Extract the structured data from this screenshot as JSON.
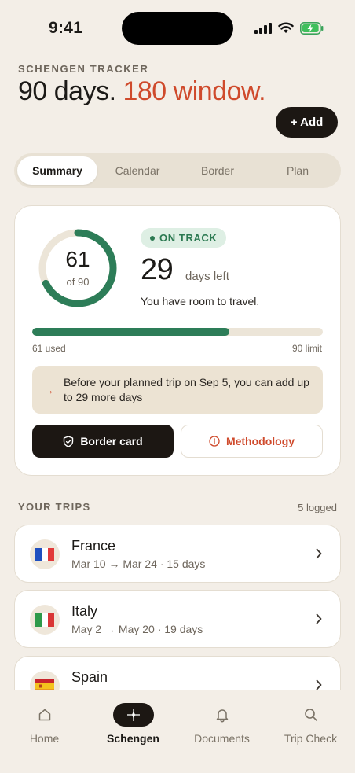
{
  "status_bar": {
    "time": "9:41"
  },
  "header": {
    "eyebrow": "SCHENGEN TRACKER",
    "headline_part1": "90 days.",
    "headline_part2": "180 window.",
    "add_label": "+ Add"
  },
  "tabs": [
    {
      "label": "Summary",
      "active": true
    },
    {
      "label": "Calendar",
      "active": false
    },
    {
      "label": "Border",
      "active": false
    },
    {
      "label": "Plan",
      "active": false
    }
  ],
  "summary": {
    "used_display": "61",
    "limit_display": "of 90",
    "used_fraction": 0.678,
    "badge": "ON TRACK",
    "days_left": "29",
    "days_left_label": "days left",
    "message": "You have room to travel.",
    "bar_left": "61 used",
    "bar_right": "90 limit",
    "note": "Before your planned trip on Sep 5, you can add up to 29 more days",
    "border_card_label": "Border card",
    "methodology_label": "Methodology"
  },
  "trips_section": {
    "title": "YOUR TRIPS",
    "count": "5 logged",
    "items": [
      {
        "name": "France",
        "dates": "Mar 10 → Mar 24 · 15 days",
        "flag": "france-flag"
      },
      {
        "name": "Italy",
        "dates": "May 2 → May 20 · 19 days",
        "flag": "italy-flag"
      },
      {
        "name": "Spain",
        "dates": "",
        "flag": "spain-flag"
      }
    ]
  },
  "tabbar": [
    {
      "label": "Home",
      "icon": "home-icon",
      "active": false
    },
    {
      "label": "Schengen",
      "icon": "compass-icon",
      "active": true
    },
    {
      "label": "Documents",
      "icon": "bell-icon",
      "active": false
    },
    {
      "label": "Trip Check",
      "icon": "search-icon",
      "active": false
    }
  ],
  "colors": {
    "background": "#f3eee7",
    "accent_red": "#cf4a2c",
    "accent_green": "#2d7d58",
    "dark": "#1c1713"
  }
}
